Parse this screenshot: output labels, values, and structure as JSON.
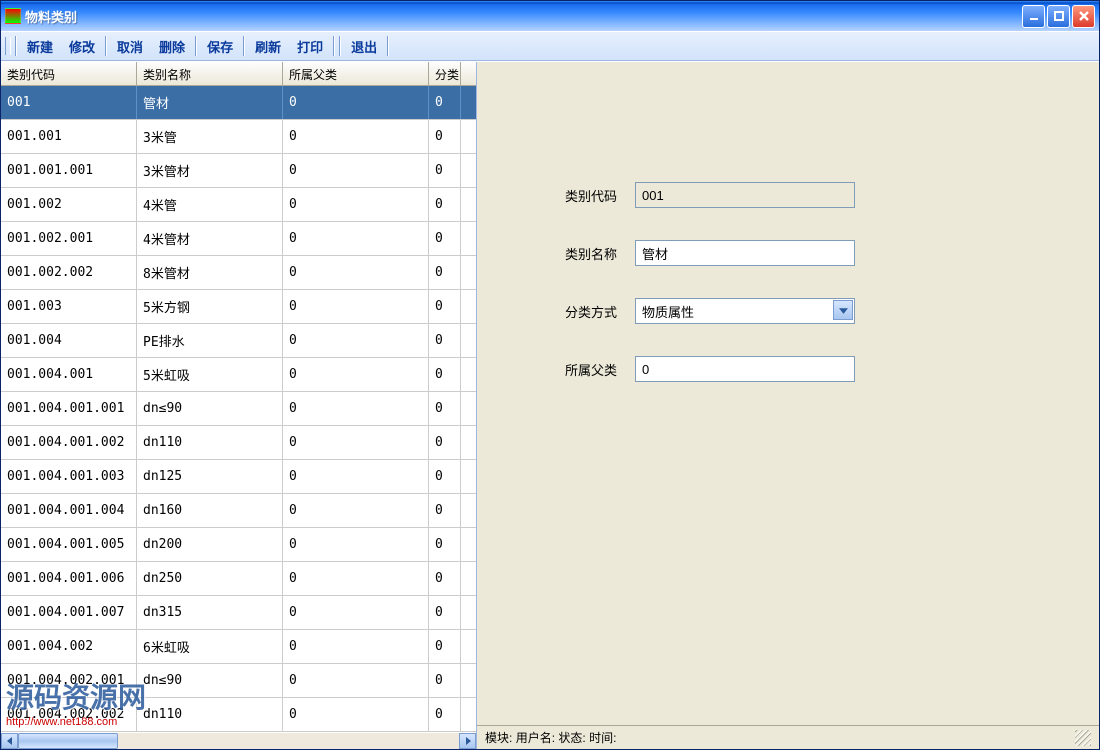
{
  "window": {
    "title": "物料类别"
  },
  "toolbar": {
    "new": "新建",
    "edit": "修改",
    "cancel": "取消",
    "delete": "删除",
    "save": "保存",
    "refresh": "刷新",
    "print": "打印",
    "exit": "退出"
  },
  "grid": {
    "headers": [
      "类别代码",
      "类别名称",
      "所属父类",
      "分类"
    ],
    "rows": [
      {
        "code": "001",
        "name": "管材",
        "parent": "0",
        "cls": "0",
        "selected": true
      },
      {
        "code": "001.001",
        "name": "3米管",
        "parent": "0",
        "cls": "0"
      },
      {
        "code": "001.001.001",
        "name": "3米管材",
        "parent": "0",
        "cls": "0"
      },
      {
        "code": "001.002",
        "name": "4米管",
        "parent": "0",
        "cls": "0"
      },
      {
        "code": "001.002.001",
        "name": "4米管材",
        "parent": "0",
        "cls": "0"
      },
      {
        "code": "001.002.002",
        "name": "8米管材",
        "parent": "0",
        "cls": "0"
      },
      {
        "code": "001.003",
        "name": "5米方钢",
        "parent": "0",
        "cls": "0"
      },
      {
        "code": "001.004",
        "name": "PE排水",
        "parent": "0",
        "cls": "0"
      },
      {
        "code": "001.004.001",
        "name": "5米虹吸",
        "parent": "0",
        "cls": "0"
      },
      {
        "code": "001.004.001.001",
        "name": "dn≤90",
        "parent": "0",
        "cls": "0"
      },
      {
        "code": "001.004.001.002",
        "name": "dn110",
        "parent": "0",
        "cls": "0"
      },
      {
        "code": "001.004.001.003",
        "name": "dn125",
        "parent": "0",
        "cls": "0"
      },
      {
        "code": "001.004.001.004",
        "name": "dn160",
        "parent": "0",
        "cls": "0"
      },
      {
        "code": "001.004.001.005",
        "name": "dn200",
        "parent": "0",
        "cls": "0"
      },
      {
        "code": "001.004.001.006",
        "name": "dn250",
        "parent": "0",
        "cls": "0"
      },
      {
        "code": "001.004.001.007",
        "name": "dn315",
        "parent": "0",
        "cls": "0"
      },
      {
        "code": "001.004.002",
        "name": "6米虹吸",
        "parent": "0",
        "cls": "0"
      },
      {
        "code": "001.004.002.001",
        "name": "dn≤90",
        "parent": "0",
        "cls": "0"
      },
      {
        "code": "001.004.002.002",
        "name": "dn110",
        "parent": "0",
        "cls": "0"
      }
    ]
  },
  "form": {
    "labels": {
      "code": "类别代码",
      "name": "类别名称",
      "mode": "分类方式",
      "parent": "所属父类"
    },
    "values": {
      "code": "001",
      "name": "管材",
      "mode": "物质属性",
      "parent": "0"
    }
  },
  "statusbar": {
    "module": "模块:",
    "user": "用户名:",
    "state": "状态:",
    "time": "时间:"
  },
  "watermark": {
    "text": "源码资源网",
    "url": "http://www.net188.com"
  }
}
